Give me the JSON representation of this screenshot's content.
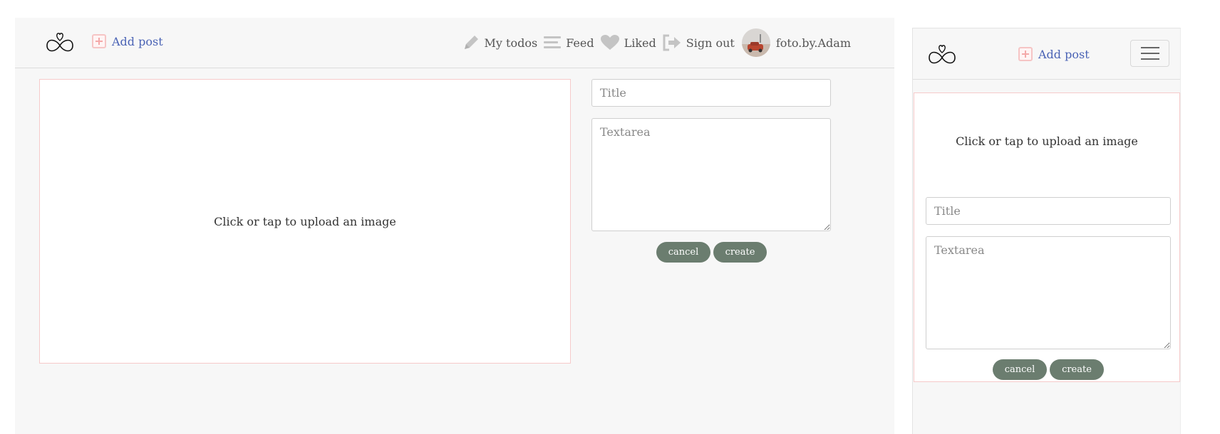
{
  "brand": {
    "logo_icon": "heart-infinity-icon"
  },
  "navbar": {
    "add_post_label": "Add post",
    "links": [
      {
        "icon": "pencil-icon",
        "label": "My todos"
      },
      {
        "icon": "bars-icon",
        "label": "Feed"
      },
      {
        "icon": "heart-icon",
        "label": "Liked"
      },
      {
        "icon": "sign-out-icon",
        "label": "Sign out"
      }
    ],
    "username": "foto.by.Adam"
  },
  "post_form": {
    "upload_prompt": "Click or tap to upload an image",
    "title_placeholder": "Title",
    "text_placeholder": "Textarea",
    "cancel_label": "cancel",
    "create_label": "create"
  },
  "colors": {
    "accent_link": "#4a63b5",
    "button_bg": "#6b7d6f",
    "upload_border": "#f6caca",
    "panel_bg": "#f7f7f7"
  }
}
